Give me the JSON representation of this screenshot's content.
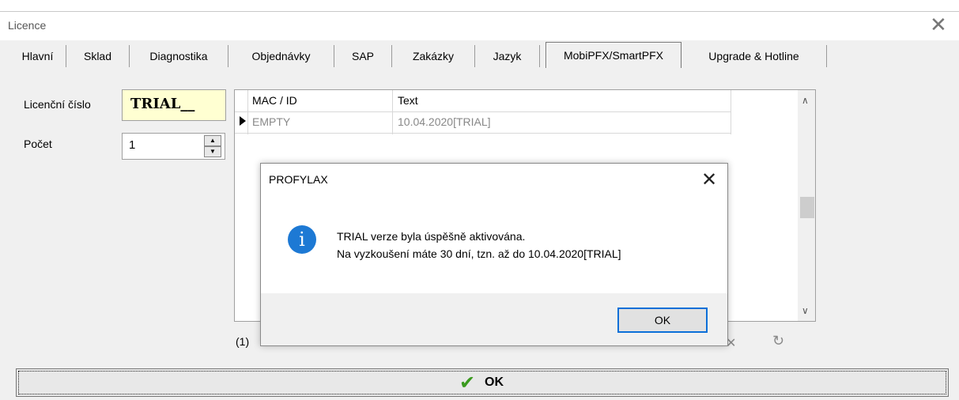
{
  "window": {
    "title": "Licence",
    "close_icon": "close-icon"
  },
  "tabs": [
    {
      "label": "Hlavní",
      "active": false
    },
    {
      "label": "Sklad",
      "active": false
    },
    {
      "label": "Diagnostika",
      "active": false
    },
    {
      "label": "Objednávky",
      "active": false
    },
    {
      "label": "SAP",
      "active": false
    },
    {
      "label": "Zakázky",
      "active": false
    },
    {
      "label": "Jazyk",
      "active": false
    },
    {
      "label": "MobiPFX/SmartPFX",
      "active": true
    },
    {
      "label": "Upgrade & Hotline",
      "active": false
    }
  ],
  "form": {
    "licence_label": "Licenční číslo",
    "licence_value": "TRIAL__",
    "count_label": "Počet",
    "count_value": "1"
  },
  "grid": {
    "columns": [
      "MAC / ID",
      "Text"
    ],
    "rows": [
      [
        "EMPTY",
        "10.04.2020[TRIAL]"
      ]
    ],
    "record_count": "(1)"
  },
  "ok_button": {
    "label": "OK"
  },
  "dialog": {
    "title": "PROFYLAX",
    "icon": "info-icon",
    "message_line1": "TRIAL verze byla úspěšně aktivována.",
    "message_line2": "Na vyzkoušení máte 30 dní, tzn. až do 10.04.2020[TRIAL]",
    "ok_label": "OK"
  },
  "colors": {
    "licence_bg": "#ffffd2",
    "accent": "#0a6fd8",
    "info": "#1d79d4",
    "check": "#3a9a1e"
  }
}
